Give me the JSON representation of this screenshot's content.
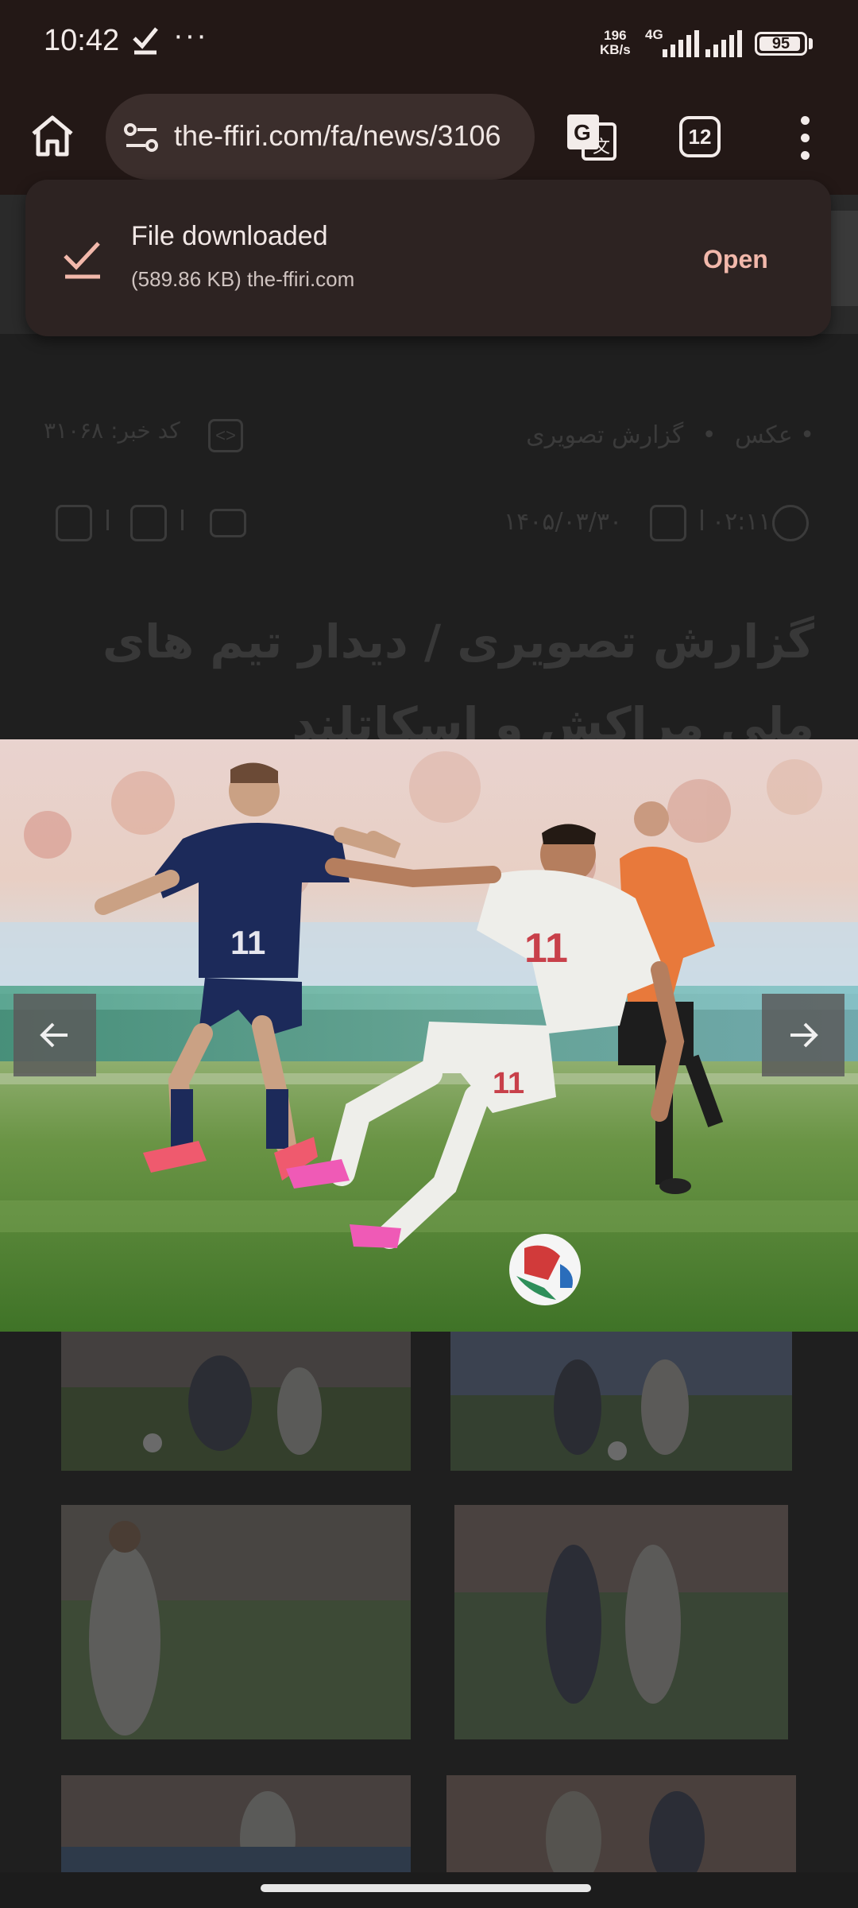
{
  "status_bar": {
    "time": "10:42",
    "more": "···",
    "net_speed_value": "196",
    "net_speed_unit": "KB/s",
    "network": "4G",
    "battery": "95",
    "battery_level": 0.95
  },
  "toolbar": {
    "url": "the-ffiri.com/fa/news/3106",
    "tab_count": "12"
  },
  "snackbar": {
    "title": "File downloaded",
    "subtitle": "(589.86 KB) the-ffiri.com",
    "action": "Open"
  },
  "article": {
    "breadcrumb": [
      "عکس",
      "گزارش تصویری"
    ],
    "news_code": "کد خبر: ۳۱۰۶۸",
    "time": "۰۲:۱۱",
    "date": "۱۴۰۵/۰۳/۳۰",
    "headline_line1": "گزارش تصویری / دیدار تیم های",
    "headline_line2": "ملی مراکش و اسکاتلند"
  },
  "colors": {
    "status_bg": "#231816",
    "url_pill": "#3b2e2c",
    "snackbar_bg": "#2d2322",
    "accent": "#f2b8ab",
    "scotland_blue": "#1c2a5a",
    "morocco_white": "#eeeeea",
    "pitch_green": "#5f8f3c"
  }
}
